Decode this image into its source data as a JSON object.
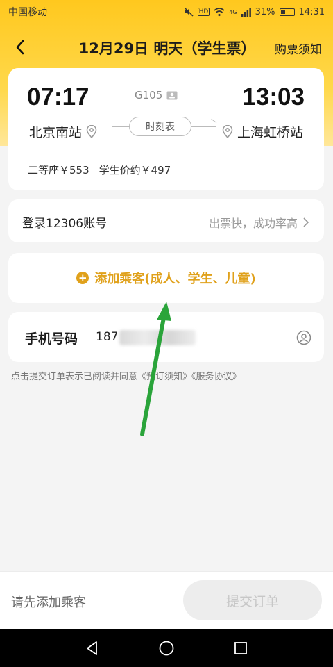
{
  "status_bar": {
    "carrier": "中国移动",
    "battery_percent": "31%",
    "time": "14:31",
    "hd_label": "HD",
    "network": "4G"
  },
  "nav": {
    "title": "12月29日 明天（学生票）",
    "right_link": "购票须知"
  },
  "train": {
    "departure_time": "07:17",
    "arrival_time": "13:03",
    "train_number": "G105",
    "departure_station": "北京南站",
    "arrival_station": "上海虹桥站",
    "timetable_label": "时刻表",
    "seat_price": "二等座￥553",
    "student_price": "学生价约￥497"
  },
  "login": {
    "label": "登录12306账号",
    "hint": "出票快，成功率高"
  },
  "add_passenger": {
    "label": "添加乘客(成人、学生、儿童)"
  },
  "phone": {
    "label": "手机号码",
    "value_prefix": "187"
  },
  "agreement": {
    "text": "点击提交订单表示已阅读并同意《预订须知》《服务协议》"
  },
  "bottom": {
    "hint": "请先添加乘客",
    "submit_label": "提交订单"
  },
  "colors": {
    "brand_yellow": "#ffc81e",
    "accent_orange": "#e0a11b",
    "annotation_green": "#2aa43a"
  }
}
